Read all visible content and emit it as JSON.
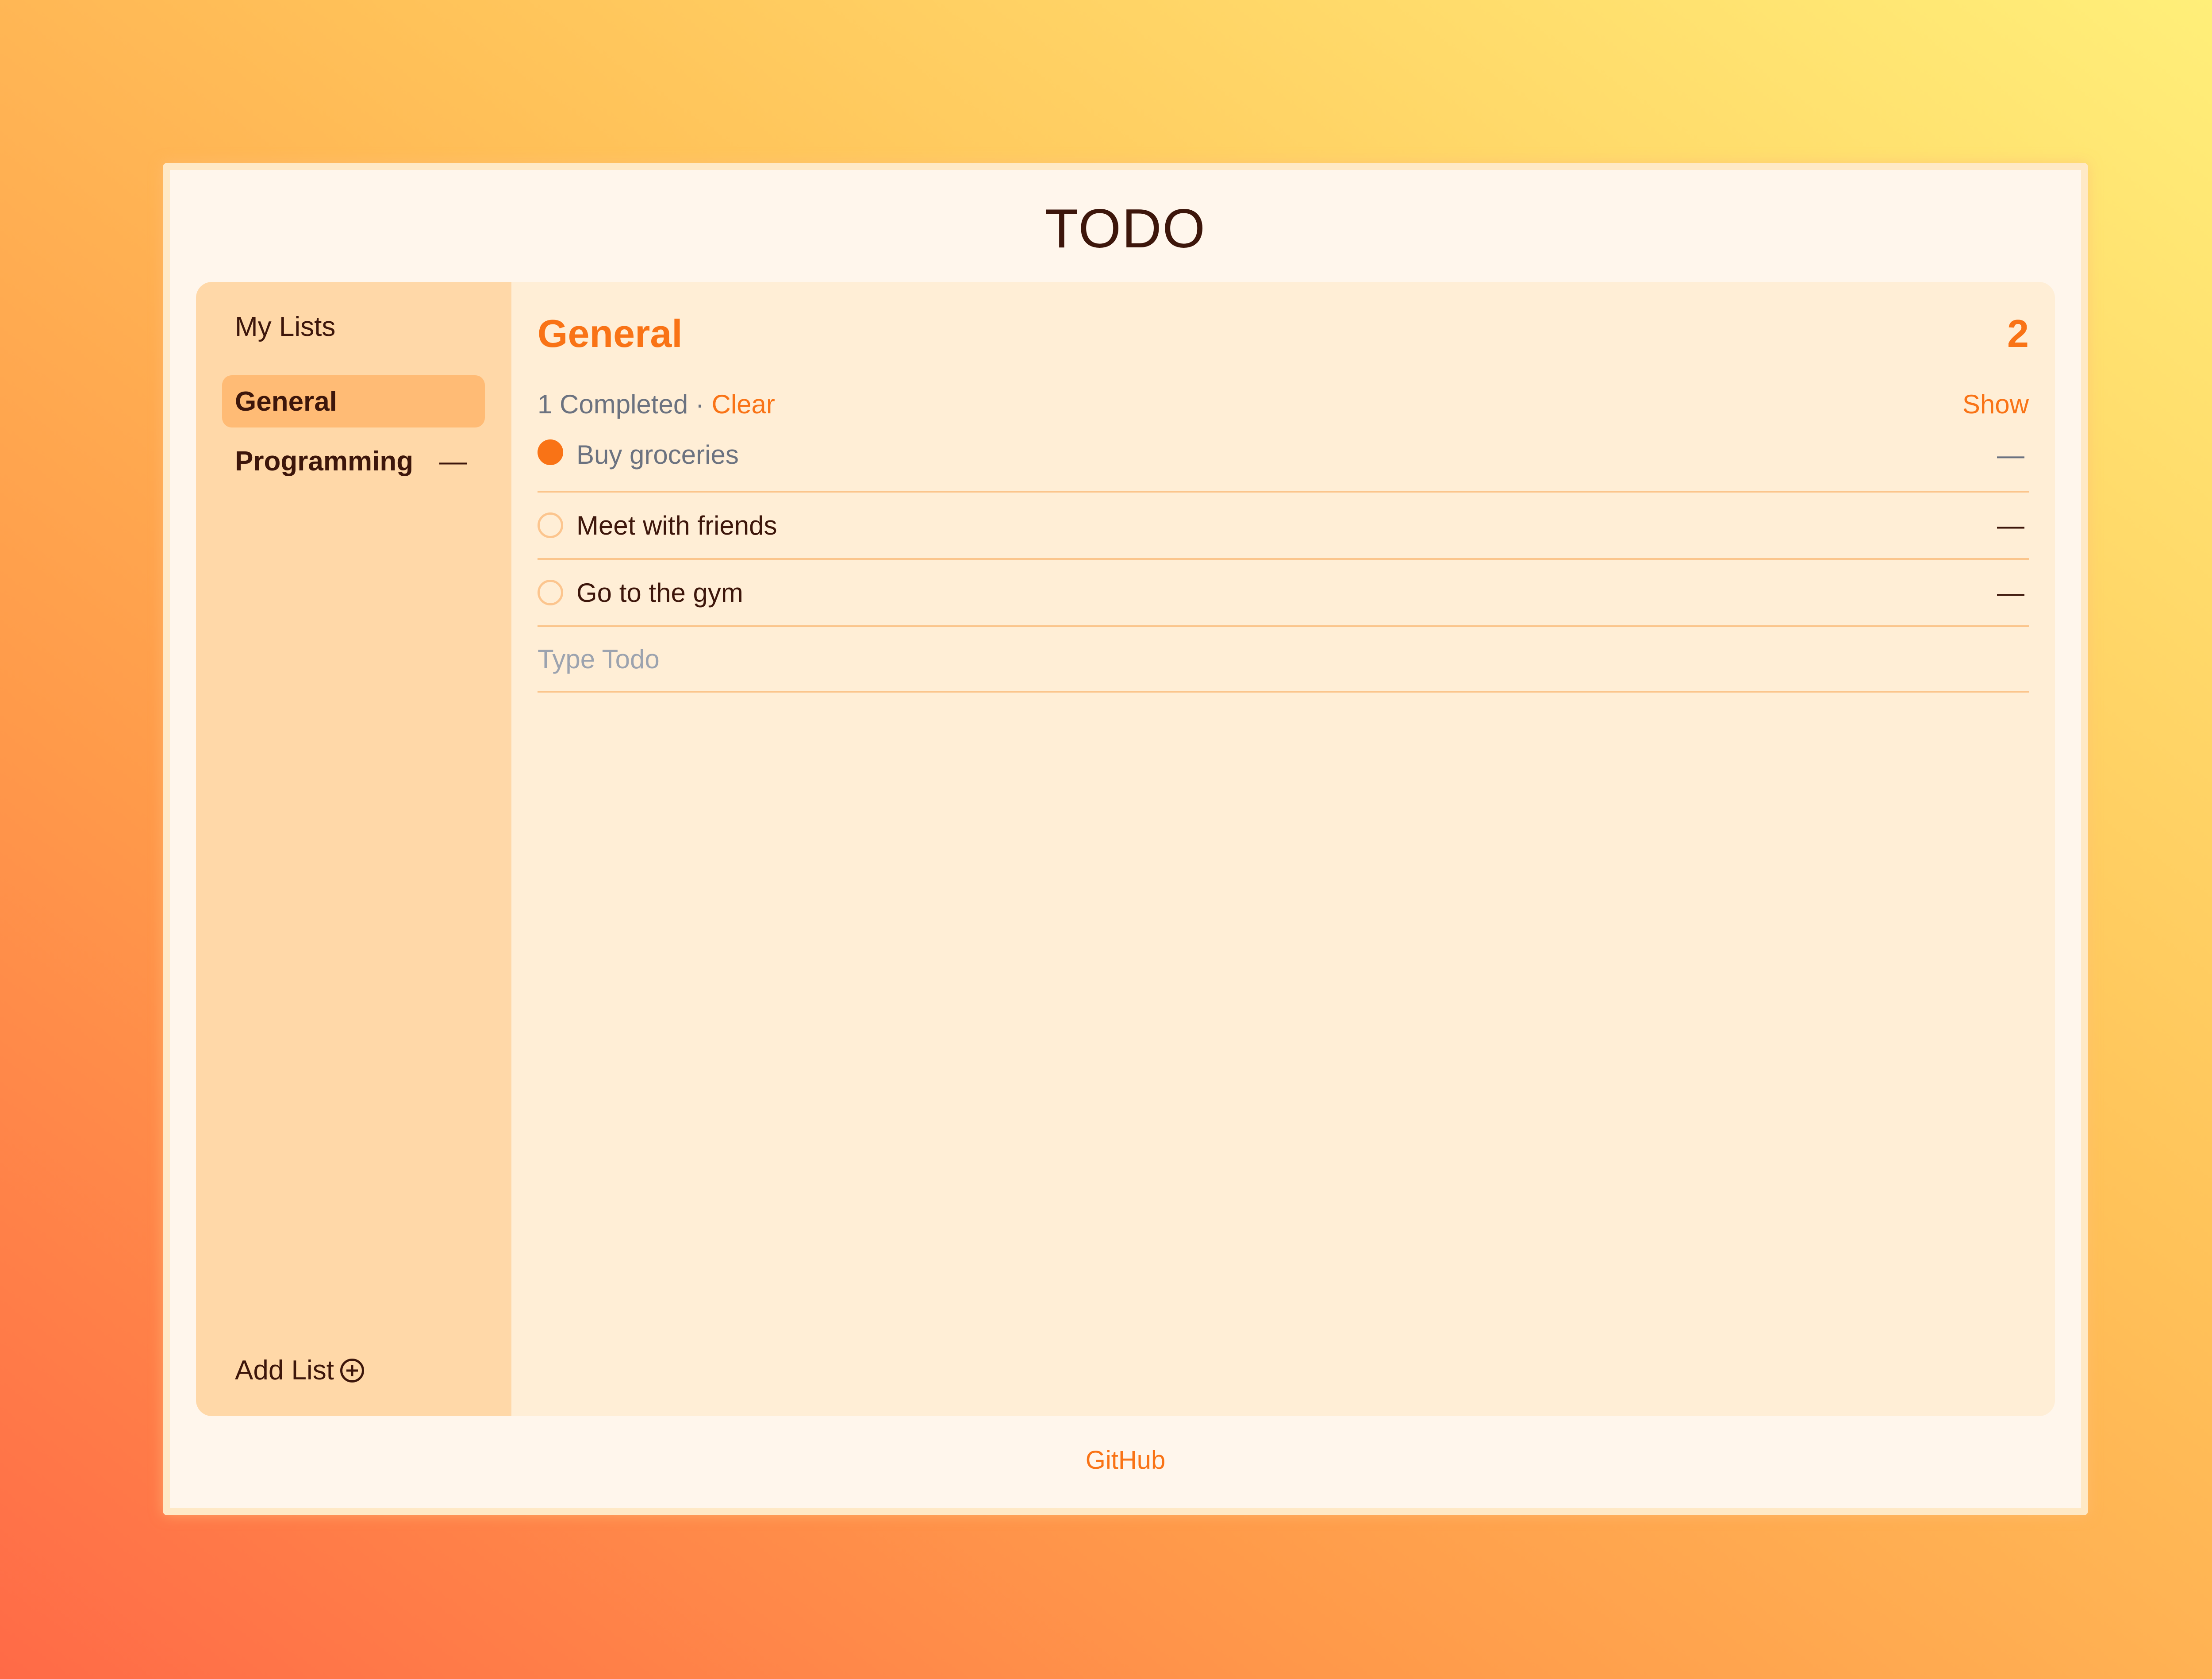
{
  "app": {
    "title": "TODO"
  },
  "sidebar": {
    "heading": "My Lists",
    "lists": [
      {
        "label": "General",
        "active": true
      },
      {
        "label": "Programming",
        "active": false,
        "remove_label": "—"
      }
    ],
    "add_list_label": "Add List",
    "add_list_icon": "plus-circle-icon"
  },
  "main": {
    "list_title": "General",
    "remaining_count": "2",
    "status": {
      "completed_text": "1 Completed ·",
      "clear_label": "Clear",
      "show_label": "Show"
    },
    "todos": [
      {
        "text": "Buy groceries",
        "completed": true,
        "remove_label": "—"
      },
      {
        "text": "Meet with friends",
        "completed": false,
        "remove_label": "—"
      },
      {
        "text": "Go to the gym",
        "completed": false,
        "remove_label": "—"
      }
    ],
    "new_todo": {
      "placeholder": "Type Todo",
      "value": ""
    }
  },
  "footer": {
    "link_label": "GitHub"
  },
  "colors": {
    "accent": "#f97316",
    "text_dark": "#3d160b",
    "sidebar_bg": "#ffd8a8",
    "main_bg": "#ffeed6",
    "active_item_bg": "#ffbb75"
  }
}
